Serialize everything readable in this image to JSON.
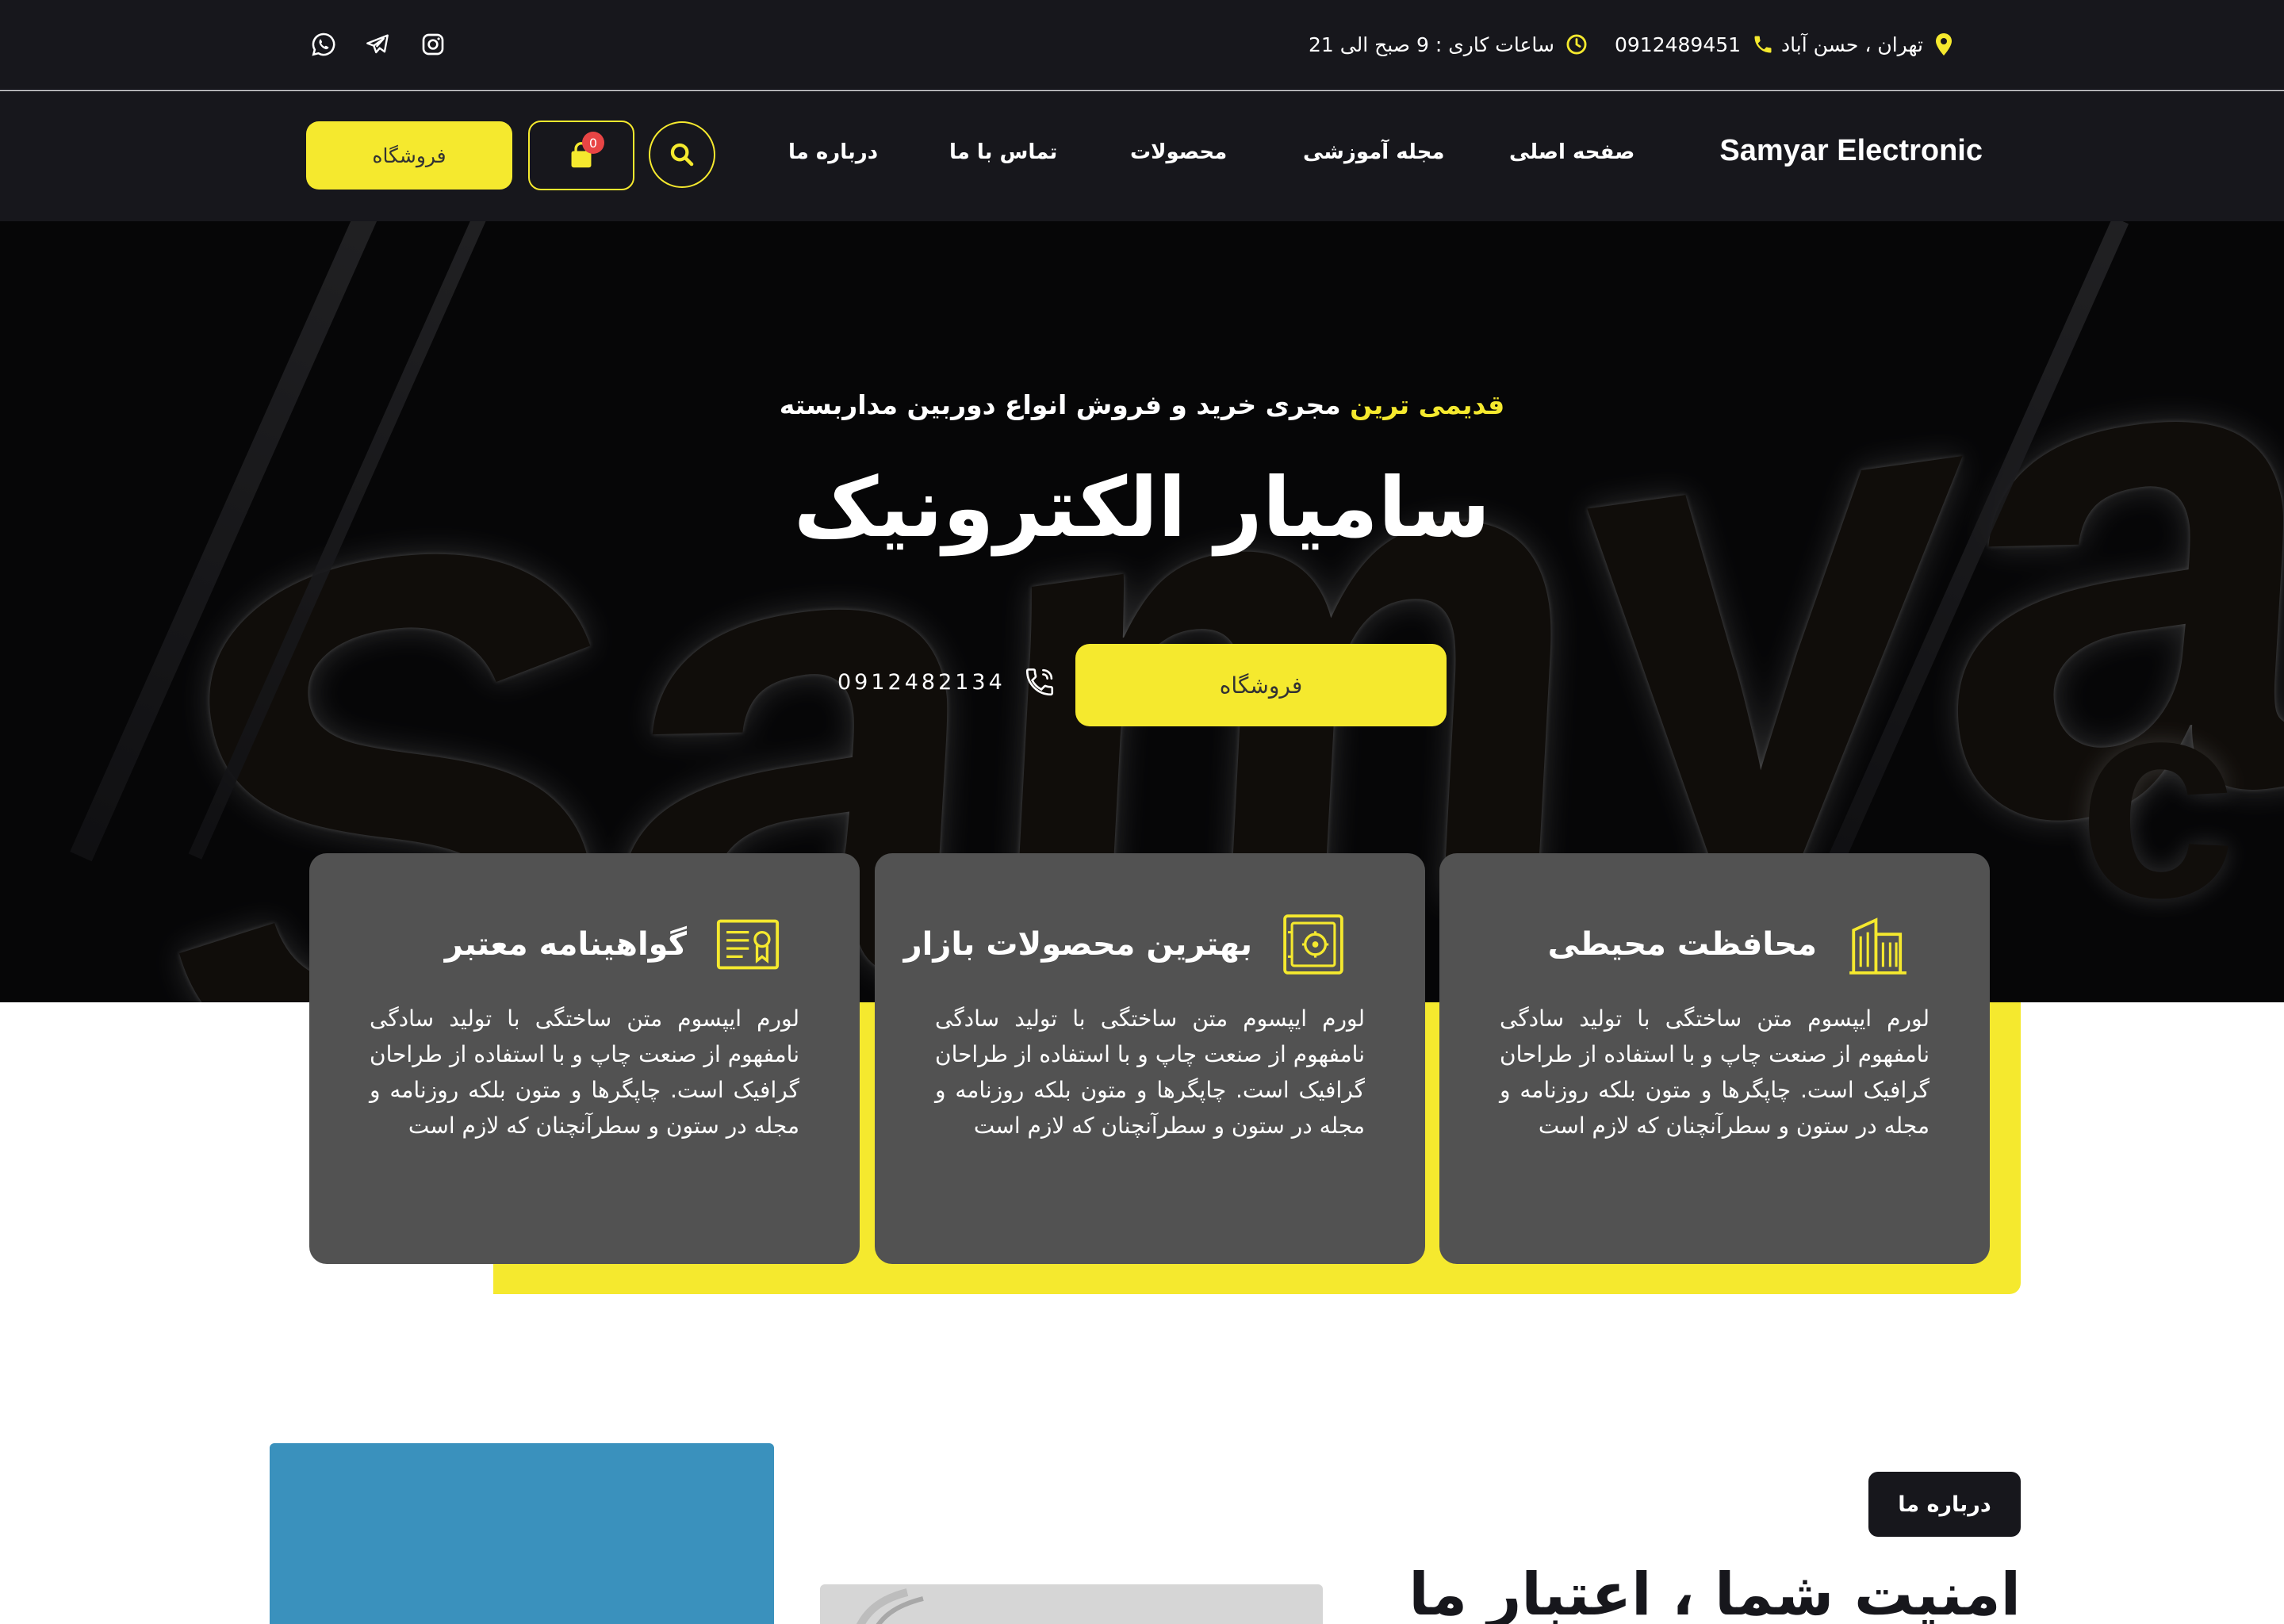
{
  "topbar": {
    "location": "تهران ، حسن آباد",
    "phone": "0912489451",
    "hours": "ساعات کاری : 9 صبح الی 21",
    "social": [
      "instagram-icon",
      "telegram-icon",
      "whatsapp-icon"
    ]
  },
  "nav": {
    "brand": "Samyar Electronic",
    "items": [
      "صفحه اصلی",
      "مجله آموزشی",
      "محصولات",
      "تماس با ما",
      "درباره ما"
    ],
    "shop_label": "فروشگاه",
    "cart_count": "0"
  },
  "hero": {
    "subtitle_highlight": "قدیمی ترین",
    "subtitle_rest": " مجری خرید و فروش انواع دوربین مداربسته",
    "title": "سامیار الکترونیک",
    "shop_label": "فروشگاه",
    "phone": "0912482134"
  },
  "features": [
    {
      "title": "محافظت محیطی",
      "icon": "building-icon",
      "text": "لورم ایپسوم متن ساختگی با تولید سادگی نامفهوم از صنعت چاپ و با استفاده از طراحان گرافیک است. چاپگرها و متون بلکه روزنامه و مجله در ستون و سطرآنچنان که لازم است"
    },
    {
      "title": "بهترین محصولات بازار",
      "icon": "safe-icon",
      "text": "لورم ایپسوم متن ساختگی با تولید سادگی نامفهوم از صنعت چاپ و با استفاده از طراحان گرافیک است. چاپگرها و متون بلکه روزنامه و مجله در ستون و سطرآنچنان که لازم است"
    },
    {
      "title": "گواهینامه معتبر",
      "icon": "certificate-icon",
      "text": "لورم ایپسوم متن ساختگی با تولید سادگی نامفهوم از صنعت چاپ و با استفاده از طراحان گرافیک است. چاپگرها و متون بلکه روزنامه و مجله در ستون و سطرآنچنان که لازم است"
    }
  ],
  "about": {
    "badge": "درباره ما",
    "title": "امنیت شما ، اعتبار ما"
  },
  "colors": {
    "accent": "#f5e92e",
    "dark": "#17171c",
    "card": "#525252",
    "badge": "#e84545"
  }
}
